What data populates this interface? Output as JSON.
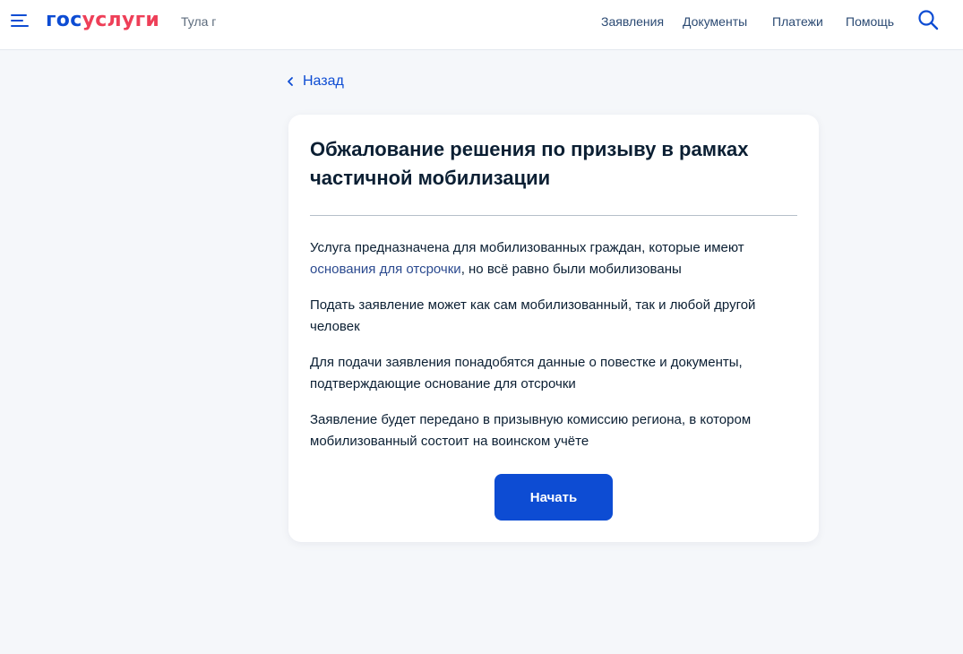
{
  "header": {
    "logo_part1": "гос",
    "logo_part2": "услуги",
    "region": "Тула г",
    "nav": [
      "Заявления",
      "Документы",
      "Платежи",
      "Помощь"
    ],
    "icons": {
      "menu": "burger-menu-icon",
      "search": "search-icon"
    },
    "colors": {
      "brand_blue": "#0d4cd3",
      "brand_red": "#ee3f58"
    }
  },
  "back": {
    "label": "Назад"
  },
  "card": {
    "title": "Обжалование решения по призыву в рамках частичной мобилизации",
    "p1_before": "Услуга предназначена для мобилизованных граждан, которые имеют ",
    "p1_link": "основания для отсрочки",
    "p1_after": ", но всё равно были мобилизованы",
    "p2": "Подать заявление может как сам мобилизованный, так и любой другой человек",
    "p3": "Для подачи заявления понадобятся данные о повестке и документы, подтверждающие основание для отсрочки",
    "p4": "Заявление будет передано в призывную комиссию региона, в котором мобилизованный состоит на воинском учёте",
    "start_button": "Начать"
  }
}
